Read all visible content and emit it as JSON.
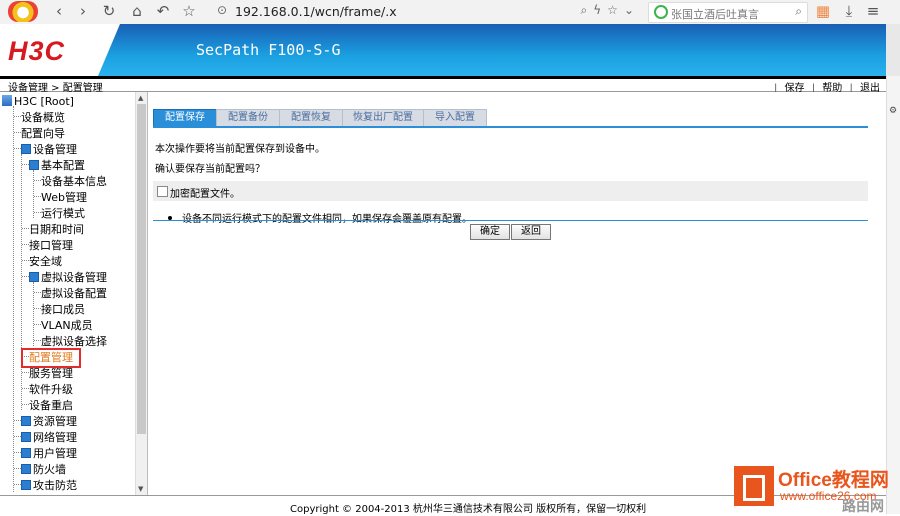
{
  "browser": {
    "url": "192.168.0.1/wcn/frame/.x",
    "search_placeholder": "张国立酒后吐真言"
  },
  "header": {
    "brand": "H3C",
    "product": "SecPath F100-S-G"
  },
  "topbar": {
    "breadcrumb": "设备管理 > 配置管理",
    "save": "保存",
    "help": "帮助",
    "logout": "退出"
  },
  "sidebar": {
    "root": "H3C [Root]",
    "items": [
      "设备概览",
      "配置向导",
      "设备管理",
      "基本配置",
      "设备基本信息",
      "Web管理",
      "运行模式",
      "日期和时间",
      "接口管理",
      "安全域",
      "虚拟设备管理",
      "虚拟设备配置",
      "接口成员",
      "VLAN成员",
      "虚拟设备选择",
      "配置管理",
      "服务管理",
      "软件升级",
      "设备重启",
      "资源管理",
      "网络管理",
      "用户管理",
      "防火墙",
      "攻击防范"
    ]
  },
  "main": {
    "tabs": [
      "配置保存",
      "配置备份",
      "配置恢复",
      "恢复出厂配置",
      "导入配置"
    ],
    "message1": "本次操作要将当前配置保存到设备中。",
    "message2": "确认要保存当前配置吗？",
    "encrypt_label": "加密配置文件。",
    "note": "设备不同运行模式下的配置文件相同，如果保存会覆盖原有配置。",
    "confirm": "确定",
    "back": "返回"
  },
  "footer": {
    "copyright": "Copyright © 2004-2013 杭州华三通信技术有限公司 版权所有，保留一切权利"
  },
  "watermark": {
    "title": "Office教程网",
    "url": "www.office26.com",
    "suffix": "路由网"
  },
  "colors": {
    "accent": "#2a8fd8",
    "brand_red": "#d71920",
    "highlight": "#e32b2b"
  }
}
